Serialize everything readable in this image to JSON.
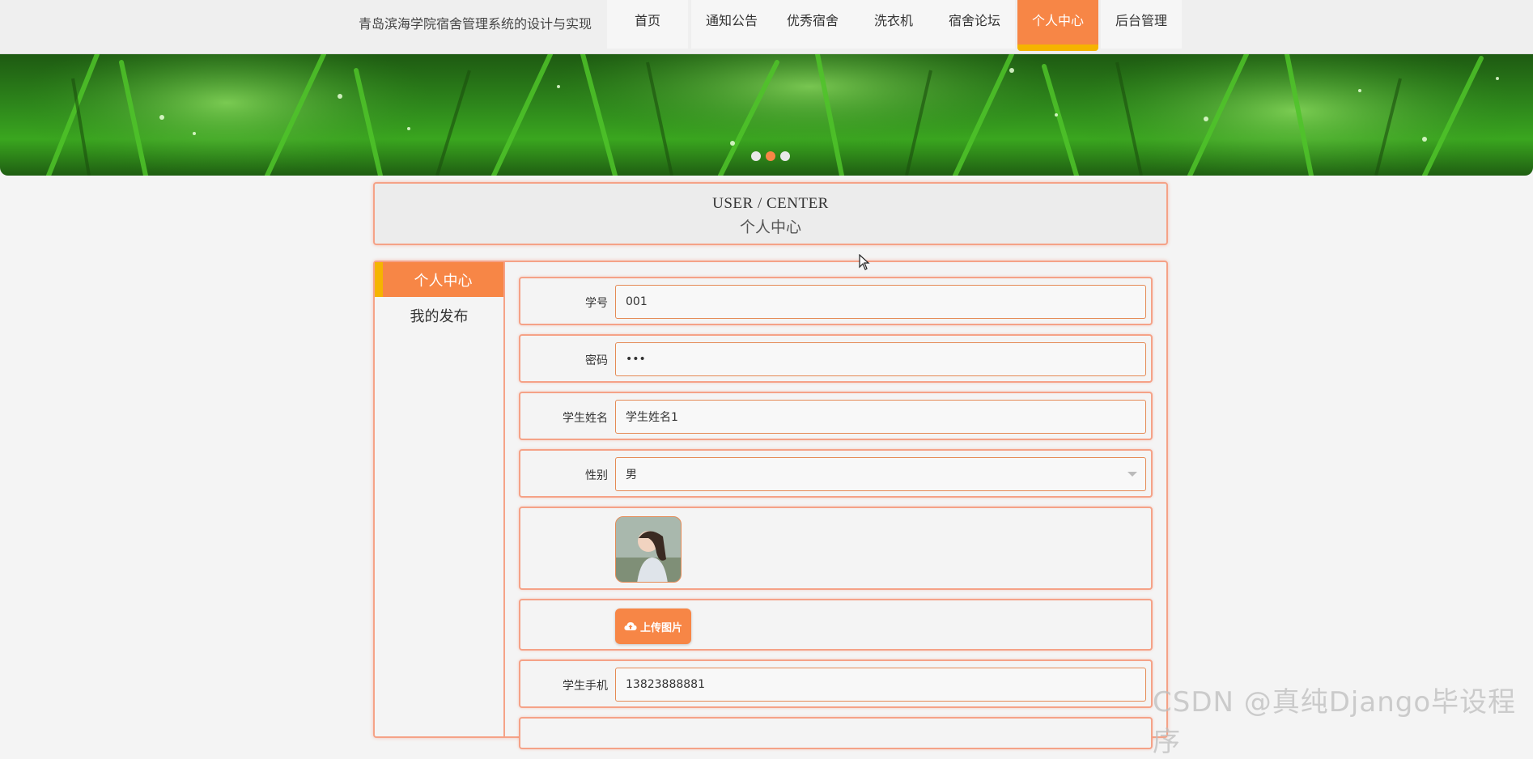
{
  "header": {
    "site_title": "青岛滨海学院宿舍管理系统的设计与实现",
    "nav": [
      {
        "label": "首页",
        "active": false
      },
      {
        "label": "通知公告",
        "active": false
      },
      {
        "label": "优秀宿舍",
        "active": false
      },
      {
        "label": "洗衣机",
        "active": false
      },
      {
        "label": "宿舍论坛",
        "active": false
      },
      {
        "label": "个人中心",
        "active": true
      },
      {
        "label": "后台管理",
        "active": false
      }
    ]
  },
  "banner": {
    "slide_count": 3,
    "active_slide": 2
  },
  "section": {
    "title_en": "USER / CENTER",
    "title_cn": "个人中心"
  },
  "sidebar": {
    "items": [
      {
        "label": "个人中心",
        "active": true
      },
      {
        "label": "我的发布",
        "active": false
      }
    ]
  },
  "form": {
    "student_id": {
      "label": "学号",
      "value": "001"
    },
    "password": {
      "label": "密码",
      "value": "•••"
    },
    "student_name": {
      "label": "学生姓名",
      "value": "学生姓名1"
    },
    "gender": {
      "label": "性别",
      "value": "男"
    },
    "upload_label": "上传图片",
    "phone": {
      "label": "学生手机",
      "value": "13823888881"
    }
  },
  "watermark": "CSDN @真纯Django毕设程序",
  "colors": {
    "accent": "#f78646",
    "accent_border": "#f5a287",
    "highlight": "#f5b400"
  }
}
